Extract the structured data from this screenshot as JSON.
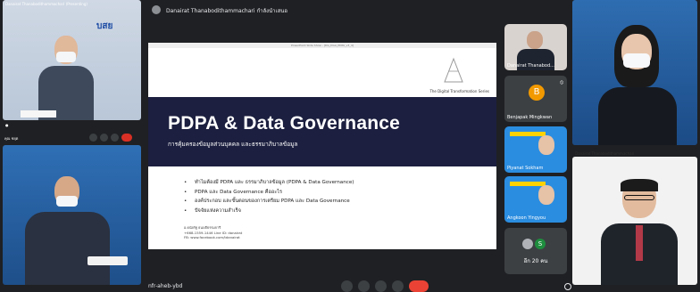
{
  "window": {
    "meeting_code": "nfr-aheb-ybd"
  },
  "presenter": {
    "name": "Danairat Thanabodithammachari กำลังนำเสนอ"
  },
  "tiles": {
    "left_top_label": "Danairat Thanabodithammachari (Presenting)",
    "left_top_org": "บสย",
    "left_bottom_label": "คุณ ชยุต",
    "right_bottom_label": "Danairat Thanabodithammachari"
  },
  "slide": {
    "header_caption": "PowerPoint Slide Show - [DG_DGA_PDPA_v3_4]",
    "series": "The Digital Transformation Series",
    "title": "PDPA & Data Governance",
    "subtitle": "การคุ้มครองข้อมูลส่วนบุคคล และธรรมาภิบาลข้อมูล",
    "bullets": [
      "ทำไมต้องมี PDPA และ ธรรมาภิบาลข้อมูล (PDPA & Data Governance)",
      "PDPA และ Data Governance คืออะไร",
      "องค์ประกอบ และขั้นตอนของการเตรียม PDPA และ Data Governance",
      "ปัจจัยแห่งความสำเร็จ"
    ],
    "author": "อ.ดนัยรัฐ ธนบดีธรรมจารี",
    "author_contact": "+668-1559-1446 Line ID: danairat",
    "author_fb": "FB: www.facebook.com/tdanairat"
  },
  "participants": [
    {
      "name": "Danairat Thanabod...",
      "initial": ""
    },
    {
      "name": "Benjapak Mingkwan",
      "initial": "B"
    },
    {
      "name": "Piyanat Sokham",
      "initial": ""
    },
    {
      "name": "Angkoon Yingyou",
      "initial": ""
    },
    {
      "name": "อีก 20 คน",
      "initial": "S"
    }
  ],
  "colors": {
    "end_call": "#ea4335",
    "slide_band": "#1c1f3f",
    "avatar_orange": "#f29900"
  }
}
